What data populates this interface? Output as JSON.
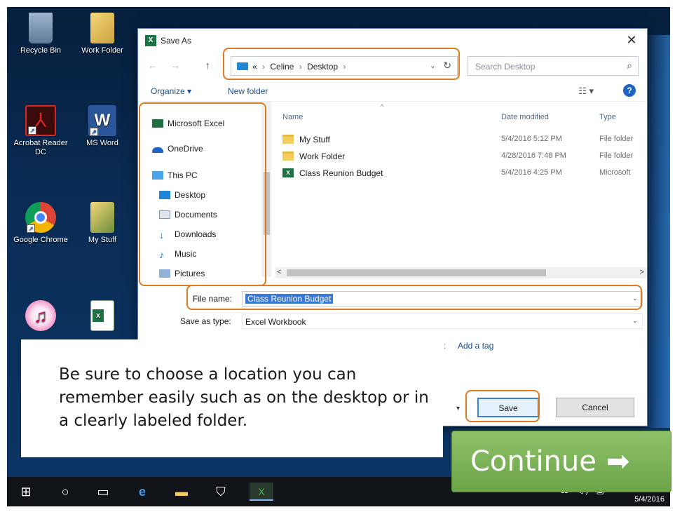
{
  "desktop": {
    "icons": [
      {
        "label": "Recycle Bin",
        "icon": "recycle-bin-icon"
      },
      {
        "label": "Work Folder",
        "icon": "folder-icon"
      },
      {
        "label": "Acrobat Reader DC",
        "icon": "acrobat-icon"
      },
      {
        "label": "MS Word",
        "icon": "word-icon"
      },
      {
        "label": "Google Chrome",
        "icon": "chrome-icon"
      },
      {
        "label": "My Stuff",
        "icon": "folder-icon"
      },
      {
        "label": "",
        "icon": "itunes-icon"
      },
      {
        "label": "",
        "icon": "excel-file-icon"
      }
    ]
  },
  "dialog": {
    "title": "Save As",
    "close": "✕",
    "address": {
      "overflow": "«",
      "crumbs": [
        "Celine",
        "Desktop"
      ],
      "separator": "›",
      "dropdown": "⌄",
      "refresh": "↻"
    },
    "search_placeholder": "Search Desktop",
    "search_icon": "⌕",
    "nav_back": "←",
    "nav_forward": "→",
    "nav_up": "↑",
    "toolbar": {
      "organize": "Organize ▾",
      "new_folder": "New folder",
      "view": "☷ ▾",
      "help": "?"
    },
    "nav_pane": [
      {
        "label": "Microsoft Excel",
        "icon": "excel-icon"
      },
      {
        "label": "OneDrive",
        "icon": "onedrive-icon"
      },
      {
        "label": "This PC",
        "icon": "this-pc-icon"
      },
      {
        "label": "Desktop",
        "icon": "desktop-icon"
      },
      {
        "label": "Documents",
        "icon": "documents-icon"
      },
      {
        "label": "Downloads",
        "icon": "downloads-icon"
      },
      {
        "label": "Music",
        "icon": "music-icon"
      },
      {
        "label": "Pictures",
        "icon": "pictures-icon"
      }
    ],
    "columns": {
      "name": "Name",
      "date": "Date modified",
      "type": "Type",
      "sort": "^"
    },
    "files": [
      {
        "name": "My Stuff",
        "date": "5/4/2016 5:12 PM",
        "type": "File folder",
        "kind": "folder"
      },
      {
        "name": "Work Folder",
        "date": "4/28/2016 7:48 PM",
        "type": "File folder",
        "kind": "folder"
      },
      {
        "name": "Class Reunion Budget",
        "date": "5/4/2016 4:25 PM",
        "type": "Microsoft",
        "kind": "excel"
      }
    ],
    "scroll_left": "<",
    "scroll_right": ">",
    "file_name_label": "File name:",
    "file_name_value": "Class Reunion Budget",
    "save_type_label": "Save as type:",
    "save_type_value": "Excel Workbook",
    "tags_link": "Add a tag",
    "save_button": "Save",
    "cancel_button": "Cancel"
  },
  "note_text": "Be sure to choose a location you can remember easily such as on the desktop or in a clearly labeled folder.",
  "continue_button": {
    "label": "Continue",
    "arrow": "➡"
  },
  "taskbar": {
    "date": "5/4/2016",
    "tray": "^ ⚏ ◁) ▣"
  },
  "colors": {
    "callout": "#e07a1c",
    "continue": "#78b050",
    "accent": "#3a78d6"
  }
}
